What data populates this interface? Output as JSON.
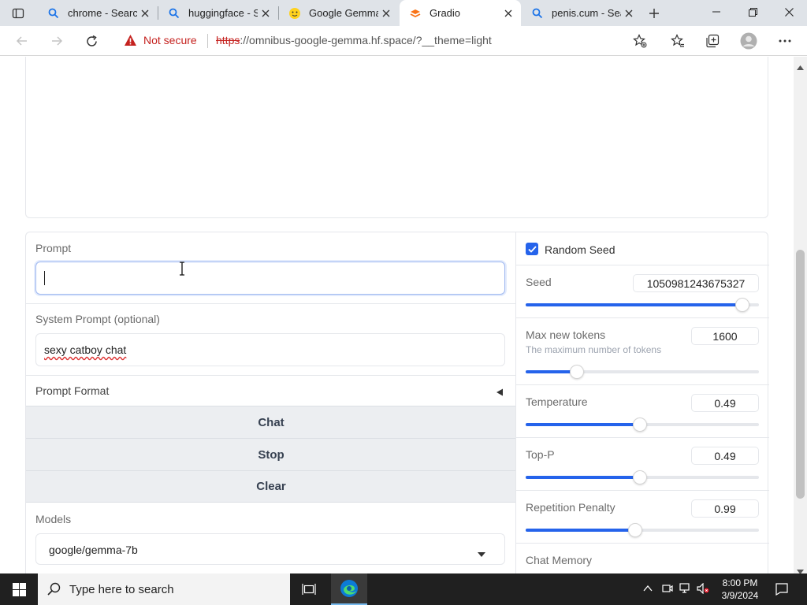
{
  "browser": {
    "tabs": [
      {
        "label": "chrome - Search",
        "icon": "search-icon"
      },
      {
        "label": "huggingface - S",
        "icon": "search-icon"
      },
      {
        "label": "Google Gemma",
        "icon": "hugging-face-icon"
      },
      {
        "label": "Gradio",
        "icon": "gradio-icon",
        "active": true
      },
      {
        "label": "penis.cum - Sea",
        "icon": "search-icon"
      }
    ],
    "security_label": "Not secure",
    "url_scheme": "https",
    "url_rest": "://omnibus-google-gemma.hf.space/?__theme=light"
  },
  "form": {
    "prompt_label": "Prompt",
    "prompt_value": "",
    "system_prompt_label": "System Prompt (optional)",
    "system_prompt_value": "sexy catboy chat",
    "prompt_format_label": "Prompt Format",
    "chat_button": "Chat",
    "stop_button": "Stop",
    "clear_button": "Clear",
    "models_label": "Models",
    "model_selected": "google/gemma-7b"
  },
  "params": {
    "random_seed_label": "Random Seed",
    "random_seed_checked": true,
    "seed": {
      "label": "Seed",
      "value": "1050981243675327",
      "fraction": 0.93
    },
    "max_tokens": {
      "label": "Max new tokens",
      "info": "The maximum number of tokens",
      "value": "1600",
      "fraction": 0.22
    },
    "temperature": {
      "label": "Temperature",
      "value": "0.49",
      "fraction": 0.49
    },
    "top_p": {
      "label": "Top-P",
      "value": "0.49",
      "fraction": 0.49
    },
    "repetition_penalty": {
      "label": "Repetition Penalty",
      "value": "0.99",
      "fraction": 0.47
    },
    "chat_memory_label": "Chat Memory"
  },
  "taskbar": {
    "search_placeholder": "Type here to search",
    "time": "8:00 PM",
    "date": "3/9/2024"
  },
  "colors": {
    "accent": "#2563eb",
    "insecure": "#c5221f"
  }
}
